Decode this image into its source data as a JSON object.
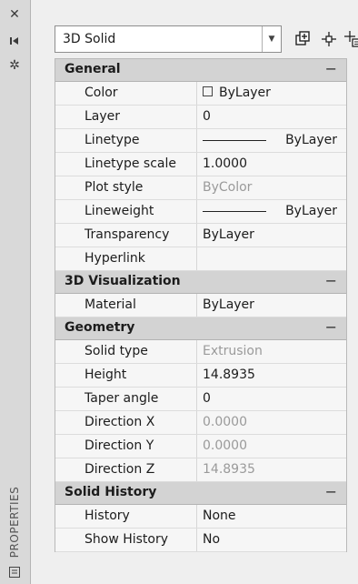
{
  "side": {
    "title": "PROPERTIES",
    "icons": [
      "close-icon",
      "auto-hide-icon",
      "settings-icon",
      "palette-icon"
    ]
  },
  "toolbar": {
    "selection": "3D Solid",
    "buttons": [
      "toggle-pickadd-icon",
      "select-objects-icon",
      "quick-select-icon"
    ]
  },
  "sections": [
    {
      "title": "General",
      "toggle": "−",
      "rows": [
        {
          "label": "Color",
          "value": "ByLayer",
          "swatch": true
        },
        {
          "label": "Layer",
          "value": "0"
        },
        {
          "label": "Linetype",
          "value": "ByLayer",
          "line": true
        },
        {
          "label": "Linetype scale",
          "value": "1.0000"
        },
        {
          "label": "Plot style",
          "value": "ByColor",
          "gray": true
        },
        {
          "label": "Lineweight",
          "value": "ByLayer",
          "line": true
        },
        {
          "label": "Transparency",
          "value": "ByLayer"
        },
        {
          "label": "Hyperlink",
          "value": ""
        }
      ]
    },
    {
      "title": "3D Visualization",
      "toggle": "−",
      "rows": [
        {
          "label": "Material",
          "value": "ByLayer"
        }
      ]
    },
    {
      "title": "Geometry",
      "toggle": "−",
      "rows": [
        {
          "label": "Solid type",
          "value": "Extrusion",
          "gray": true
        },
        {
          "label": "Height",
          "value": "14.8935"
        },
        {
          "label": "Taper angle",
          "value": "0"
        },
        {
          "label": "Direction X",
          "value": "0.0000",
          "gray": true
        },
        {
          "label": "Direction Y",
          "value": "0.0000",
          "gray": true
        },
        {
          "label": "Direction Z",
          "value": "14.8935",
          "gray": true
        }
      ]
    },
    {
      "title": "Solid History",
      "toggle": "−",
      "rows": [
        {
          "label": "History",
          "value": "None"
        },
        {
          "label": "Show History",
          "value": "No"
        }
      ]
    }
  ]
}
